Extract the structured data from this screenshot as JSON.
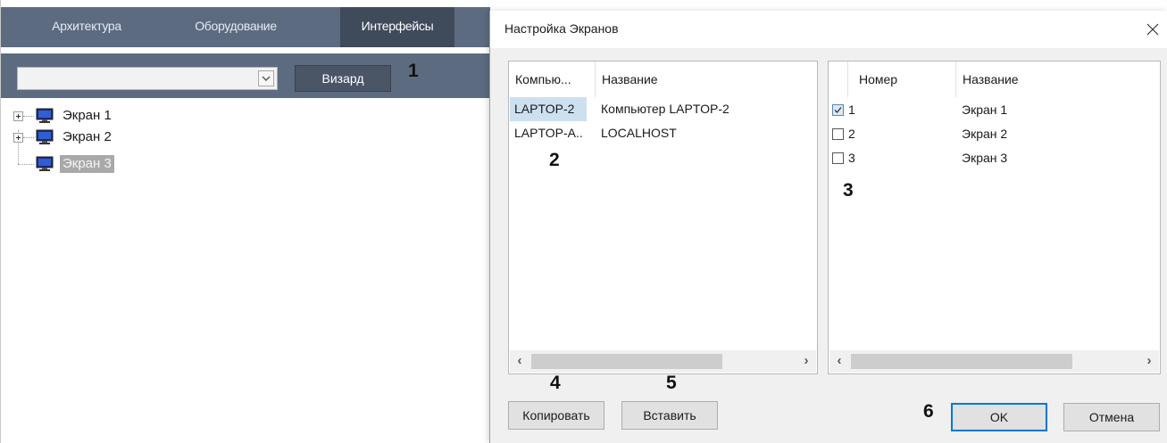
{
  "app": {
    "tabs": [
      {
        "label": "Архитектура"
      },
      {
        "label": "Оборудование"
      },
      {
        "label": "Интерфейсы"
      }
    ],
    "combo_value": "",
    "wizard_label": "Визард",
    "tree": [
      {
        "label": "Экран 1",
        "expandable": true
      },
      {
        "label": "Экран 2",
        "expandable": true
      },
      {
        "label": "Экран 3",
        "expandable": false,
        "selected": true
      }
    ]
  },
  "markers": {
    "m1": "1",
    "m2": "2",
    "m3": "3",
    "m4": "4",
    "m5": "5",
    "m6": "6"
  },
  "dialog": {
    "title": "Настройка Экранов",
    "computers": {
      "headers": [
        "Компью...",
        "Название"
      ],
      "rows": [
        {
          "computer": "LAPTOP-2",
          "name": "Компьютер LAPTOP-2"
        },
        {
          "computer": "LAPTOP-A..",
          "name": "LOCALHOST"
        }
      ]
    },
    "screens": {
      "headers": [
        "Номер",
        "Название"
      ],
      "rows": [
        {
          "number": "1",
          "name": "Экран 1",
          "checked": true
        },
        {
          "number": "2",
          "name": "Экран 2",
          "checked": false
        },
        {
          "number": "3",
          "name": "Экран 3",
          "checked": false
        }
      ]
    },
    "buttons": {
      "copy": "Копировать",
      "paste": "Вставить",
      "ok": "OK",
      "cancel": "Отмена"
    }
  },
  "colors": {
    "toolbar": "#5c6b80",
    "active_tab": "#3f4a5b",
    "selection": "#cde0f0",
    "default_button_border": "#0078d7"
  }
}
